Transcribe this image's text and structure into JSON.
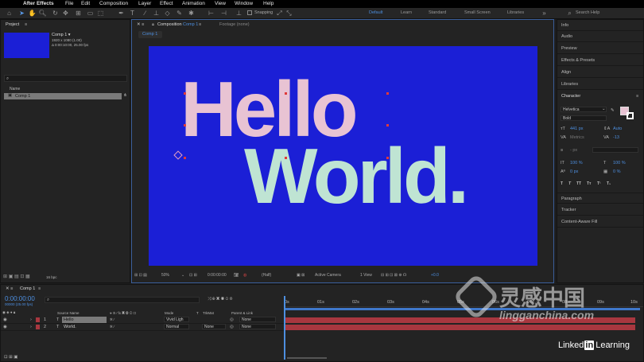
{
  "app": {
    "apple_glyph": "",
    "name": "After Effects"
  },
  "menu": [
    "File",
    "Edit",
    "Composition",
    "Layer",
    "Effect",
    "Animation",
    "View",
    "Window",
    "Help"
  ],
  "toolbar": {
    "snapping_label": "Snapping"
  },
  "workspaces": [
    "Default",
    "Learn",
    "Standard",
    "Small Screen",
    "Libraries"
  ],
  "search_help": {
    "placeholder": "Search Help"
  },
  "project": {
    "title": "Project",
    "item_name": "Comp 1 ▾",
    "item_info1": "1920 x 1080 (1.00)",
    "item_info2": "Δ 0:00:10:00, 25.00 fps",
    "search_glyph": "⌕",
    "column_name": "Name",
    "row_label": "Comp 1",
    "bpc": "16 bpc"
  },
  "composition": {
    "tab_label": "Composition",
    "tab_comp": "Comp 1",
    "footage_tab": "Footage (none)",
    "subtab": "Comp 1",
    "text_line1": "Hello",
    "text_line2": "World.",
    "bg_color": "#1b1fd6",
    "hello_color": "#e8c3d3",
    "world_color": "#bfe4d3",
    "zoom": "50%",
    "timecode": "0:00:00:00",
    "resolution": "(Half)",
    "camera": "Active Camera",
    "views": "1 View",
    "exposure": "+0.0"
  },
  "right_panels": {
    "top": [
      "Info",
      "Audio",
      "Preview",
      "Effects & Presets",
      "Align",
      "Libraries"
    ],
    "character": "Character",
    "bottom": [
      "Paragraph",
      "Tracker",
      "Content-Aware Fill"
    ]
  },
  "character": {
    "font": "Helvetica",
    "style": "Bold",
    "font_size": "441 px",
    "leading": "Auto",
    "kerning": "Metrics",
    "tracking": "-13",
    "stroke": "- px",
    "vscale": "100 %",
    "hscale": "100 %",
    "baseline": "0 px",
    "tsume": "0 %",
    "caps_buttons": [
      "T",
      "T",
      "TT",
      "Tт",
      "T¹",
      "T₁"
    ],
    "fill_color": "#e8c3d3"
  },
  "timeline": {
    "tab": "Comp 1",
    "timecode": "0:00:00:00",
    "frames": "00000 (25.00 fps)",
    "col_source": "Source Name",
    "col_mode": "Mode",
    "col_trkmat": "TrkMat",
    "col_parent": "Parent & Link",
    "layers": [
      {
        "num": "1",
        "name": "Hello",
        "mode": "Vivid Ligh",
        "trkmat": "",
        "parent": "None"
      },
      {
        "num": "2",
        "name": "World.",
        "mode": "Normal",
        "trkmat": "None",
        "parent": "None"
      }
    ],
    "ruler": [
      "0s",
      "01s",
      "02s",
      "03s",
      "04s",
      "05s",
      "06s",
      "07s",
      "08s",
      "09s",
      "10s"
    ],
    "layer_color": "#a8373f"
  },
  "watermark": {
    "cn": "灵感中国",
    "url": "lingganchina.com"
  },
  "linkedin": {
    "prefix": "Linked",
    "in": "in",
    "suffix": "Learning"
  }
}
